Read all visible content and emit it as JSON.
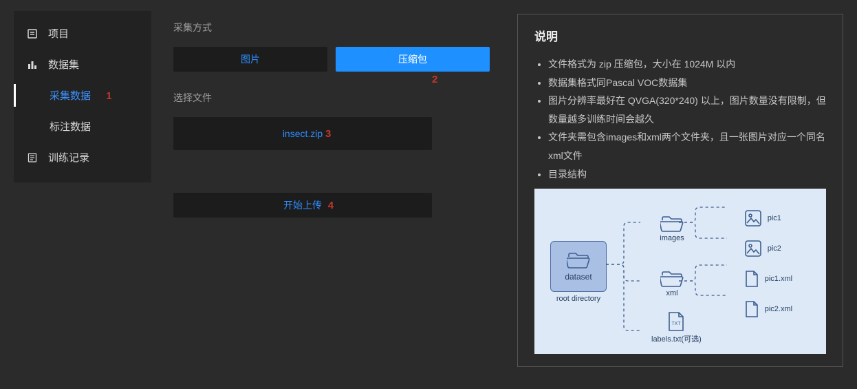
{
  "sidebar": {
    "project": "项目",
    "dataset": "数据集",
    "collect": "采集数据",
    "annotate": "标注数据",
    "training": "训练记录"
  },
  "annotations": {
    "a1": "1",
    "a2": "2",
    "a3": "3",
    "a4": "4"
  },
  "form": {
    "collect_method_label": "采集方式",
    "tab_image": "图片",
    "tab_zip": "压缩包",
    "select_file_label": "选择文件",
    "file_name": "insect.zip",
    "upload": "开始上传"
  },
  "info": {
    "title": "说明",
    "items": [
      "文件格式为 zip 压缩包，大小在 1024M 以内",
      "数据集格式同Pascal VOC数据集",
      "图片分辨率最好在 QVGA(320*240) 以上，图片数量没有限制，但数量越多训练时间会越久",
      "文件夹需包含images和xml两个文件夹，且一张图片对应一个同名xml文件",
      "目录结构"
    ]
  },
  "diagram": {
    "root": "dataset",
    "root_label": "root directory",
    "folder_images": "images",
    "folder_xml": "xml",
    "pic1": "pic1",
    "pic2": "pic2",
    "pic1xml": "pic1.xml",
    "pic2xml": "pic2.xml",
    "labels": "labels.txt(可选)"
  }
}
